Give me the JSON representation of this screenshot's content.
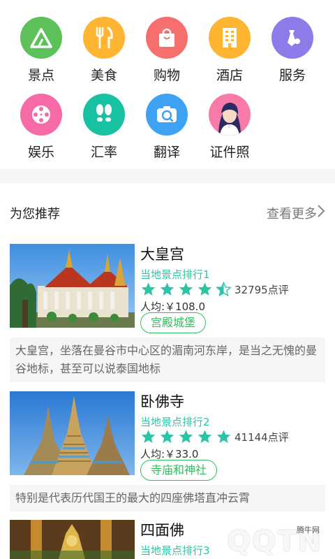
{
  "categories": [
    {
      "label": "景点",
      "icon": "mountain-icon",
      "color": "#5cc159"
    },
    {
      "label": "美食",
      "icon": "fork-knife-icon",
      "color": "#ffb432"
    },
    {
      "label": "购物",
      "icon": "shopping-bag-icon",
      "color": "#f76f6c"
    },
    {
      "label": "酒店",
      "icon": "building-icon",
      "color": "#ffb432"
    },
    {
      "label": "服务",
      "icon": "service-tie-icon",
      "color": "#8d7bea"
    },
    {
      "label": "娱乐",
      "icon": "film-reel-icon",
      "color": "#f76aa8"
    },
    {
      "label": "汇率",
      "icon": "footprints-icon",
      "color": "#19c1a3"
    },
    {
      "label": "翻译",
      "icon": "camera-translate-icon",
      "color": "#3ea2f4"
    },
    {
      "label": "证件照",
      "icon": "id-photo-avatar-icon",
      "color": "#f77aa8"
    }
  ],
  "recommend": {
    "title": "为您推荐",
    "more": "查看更多"
  },
  "items": [
    {
      "name": "大皇宫",
      "rank": "当地景点排行1",
      "rating": 4.5,
      "reviews": "32795点评",
      "price": "人均:￥108.0",
      "tag": "宫殿城堡",
      "desc": "大皇宫，坐落在曼谷市中心区的湄南河东岸，是当之无愧的曼谷地标，甚至可以说泰国地标"
    },
    {
      "name": "卧佛寺",
      "rank": "当地景点排行2",
      "rating": 5,
      "reviews": "41144点评",
      "price": "人均:￥33.0",
      "tag": "寺庙和神社",
      "desc": "特别是代表历代国王的最大的四座佛塔直冲云霄"
    },
    {
      "name": "四面佛",
      "rank": "当地景点排行3"
    }
  ],
  "watermark": {
    "brand": "QQTN",
    "site": "腾牛网"
  },
  "colors": {
    "accent": "#2cc3a7",
    "tag": "#2ec05a",
    "star": "#2cc3a7"
  }
}
